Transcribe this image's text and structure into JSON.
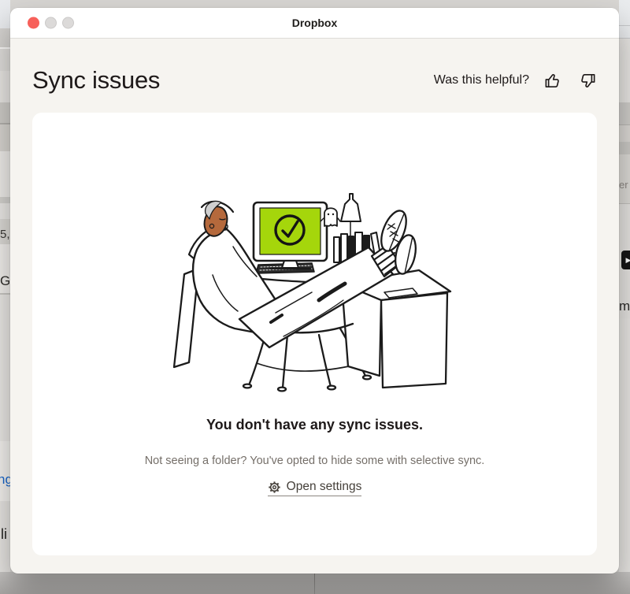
{
  "window": {
    "title": "Dropbox",
    "traffic_lights": [
      "close",
      "minimize",
      "zoom"
    ]
  },
  "header": {
    "title": "Sync issues",
    "feedback_prompt": "Was this helpful?"
  },
  "card": {
    "primary_message": "You don't have any sync issues.",
    "secondary_message": "Not seeing a folder? You've opted to hide some with selective sync.",
    "settings_link_label": "Open settings"
  },
  "icons": {
    "thumbs_up": "thumbs-up-icon",
    "thumbs_down": "thumbs-down-icon",
    "gear": "gear-icon",
    "illustration": "person-reclining-with-feet-on-desk-green-check-monitor"
  },
  "colors": {
    "screen_green": "#a5d60b",
    "close_button_red": "#f7605a",
    "body_beige": "#f6f4f0",
    "card_white": "#ffffff",
    "text_primary": "#1e1919",
    "text_secondary": "#756f69",
    "link_text": "#45403a",
    "fragment_link_blue": "#1465cc"
  },
  "background_fragments": {
    "left": [
      {
        "text": "5,"
      },
      {
        "text": "G"
      },
      {
        "text": "ng"
      },
      {
        "text": "li"
      }
    ],
    "right": [
      {
        "text": "er"
      },
      {
        "text": "m"
      }
    ]
  }
}
